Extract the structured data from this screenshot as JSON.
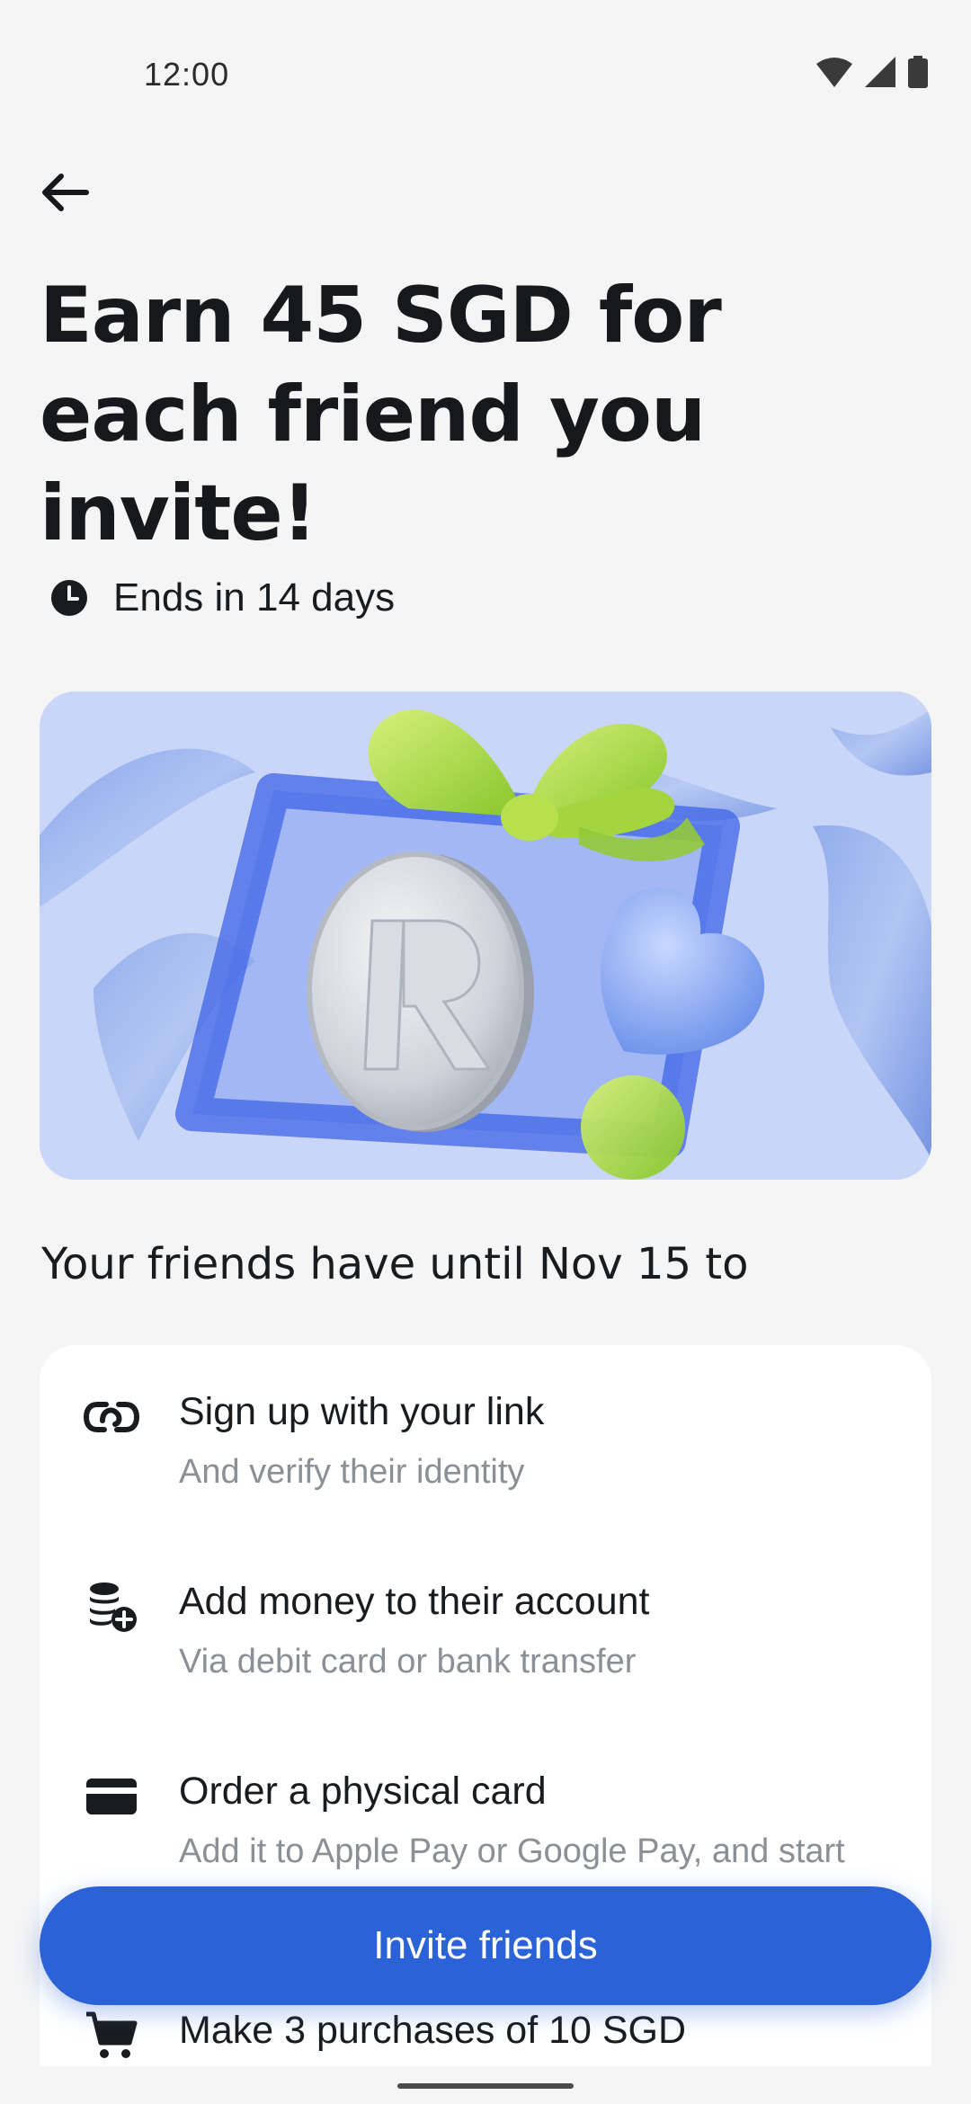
{
  "status_bar": {
    "time": "12:00"
  },
  "header": {
    "back_label": "Back"
  },
  "hero": {
    "headline": "Earn 45 SGD for each friend you invite!",
    "deadline": "Ends in 14 days"
  },
  "steps": {
    "section_title": "Your friends have until Nov 15 to",
    "items": [
      {
        "title": "Sign up with your link",
        "subtitle": "And verify their identity",
        "icon": "link-icon"
      },
      {
        "title": "Add money to their account",
        "subtitle": "Via debit card or bank transfer",
        "icon": "coins-add-icon"
      },
      {
        "title": "Order a physical card",
        "subtitle": "Add it to Apple Pay or Google Pay, and start",
        "icon": "card-icon"
      },
      {
        "title": "Make 3 purchases of 10 SGD",
        "subtitle": "",
        "icon": "cart-icon"
      }
    ]
  },
  "cta": {
    "label": "Invite friends"
  },
  "colors": {
    "accent": "#2c62d8",
    "background": "#f5f5f6",
    "card": "#ffffff",
    "hero_bg": "#c9d6f7"
  }
}
